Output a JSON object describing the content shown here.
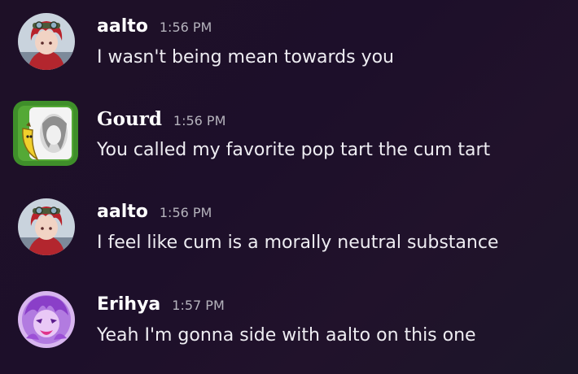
{
  "messages": [
    {
      "author": "aalto",
      "timestamp": "1:56 PM",
      "text": "I wasn't being mean towards you",
      "avatar_icon": "red-haired-character-avatar-icon"
    },
    {
      "author": "Gourd",
      "timestamp": "1:56 PM",
      "text": "You called my favorite pop tart the cum tart",
      "avatar_icon": "banana-and-character-avatar-icon"
    },
    {
      "author": "aalto",
      "timestamp": "1:56 PM",
      "text": "I feel like cum is a morally neutral substance",
      "avatar_icon": "red-haired-character-avatar-icon"
    },
    {
      "author": "Erihya",
      "timestamp": "1:57 PM",
      "text": "Yeah I'm gonna side with aalto on this one",
      "avatar_icon": "purple-character-avatar-icon"
    }
  ],
  "colors": {
    "background": "#1d0f2a",
    "username": "#ffffff",
    "timestamp": "#b5b3bc",
    "message_text": "#eeedf2"
  }
}
